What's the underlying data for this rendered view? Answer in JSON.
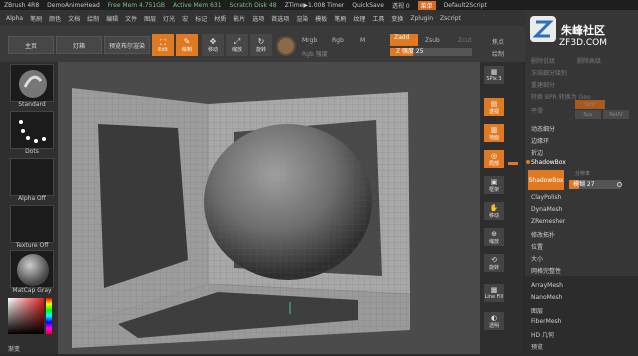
{
  "titlebar": {
    "app": "ZBrush 4R8",
    "doc": "DemoAnimeHead",
    "free_mem": "Free Mem 4.751GB",
    "active_mem": "Active Mem 631",
    "scratch": "Scratch Disk 48",
    "ztime": "ZTime▶1.008 Timer",
    "quicksave": "QuickSave",
    "transparency": "透视 0",
    "menu_btn": "菜单",
    "script": "Default2Script"
  },
  "menubar": [
    "Alpha",
    "笔刷",
    "颜色",
    "文档",
    "绘制",
    "编辑",
    "文件",
    "图层",
    "灯光",
    "宏",
    "标记",
    "材质",
    "影片",
    "选项",
    "首选项",
    "渲染",
    "模板",
    "笔刷",
    "纹理",
    "工具",
    "变换",
    "Zplugin",
    "Zscript"
  ],
  "toolbar": {
    "home": "主页",
    "lightbox": "灯箱",
    "preview": "预览布尔渲染",
    "edit": "Edit",
    "draw": "绘制",
    "move": "移动",
    "scale": "缩放",
    "rotate": "旋转",
    "mrgb": "Mrgb",
    "rgb": "Rgb",
    "m": "M",
    "rgb_strength": "Rgb 强度",
    "zadd": "Zadd",
    "zsub": "Zsub",
    "zcut": "Zcut",
    "z_strength": "Z 强度 25",
    "focal": "焦点",
    "draw_size": "绘制"
  },
  "left": {
    "brush": "Standard",
    "stroke": "Dots",
    "alpha": "Alpha Off",
    "texture": "Texture Off",
    "material": "MatCap Gray",
    "gradient": "渐变"
  },
  "right_tools": [
    "SPix 3",
    "透视",
    "地面",
    "局部",
    "框架",
    "移动",
    "缩放",
    "旋转",
    "Line Fill",
    "透明"
  ],
  "panel": {
    "logo_line1": "朱峰社区",
    "logo_line2": "ZF3D.COM",
    "dim_items": [
      "删除低级",
      "删除高级",
      "冻结细分级别",
      "重建细分",
      "转换 BPR 转换为 Geo",
      "平滑"
    ],
    "suv": "Suv",
    "reuv": "ReUV",
    "smt": "Smt",
    "items_top": [
      "动态细分",
      "边缘环",
      "折边"
    ],
    "shadowbox_title": "ShadowBox",
    "shadowbox_btn": "ShadowBox",
    "res_label": "分辨率",
    "blur_label": "模糊 27",
    "items_mid": [
      "ClayPolish",
      "DynaMesh",
      "ZRemesher",
      "修改拓扑",
      "位置",
      "大小",
      "网格完整性"
    ],
    "items_bottom": [
      "ArrayMesh",
      "NanoMesh",
      "图层",
      "FiberMesh",
      "HD 几何",
      "预览"
    ]
  }
}
